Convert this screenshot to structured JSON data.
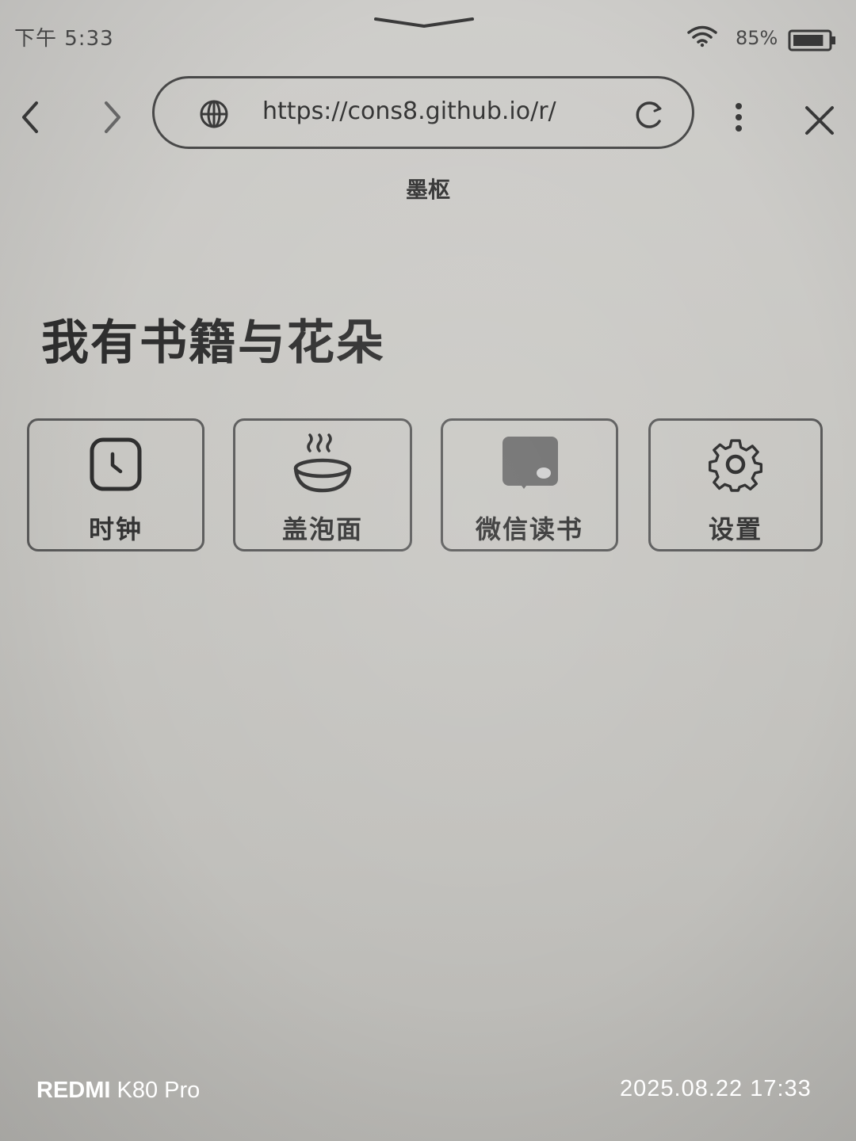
{
  "status_bar": {
    "time": "下午 5:33",
    "battery_percent": "85%",
    "battery_level": 0.85
  },
  "browser": {
    "url": "https://cons8.github.io/r/",
    "page_title": "墨枢"
  },
  "page": {
    "heading": "我有书籍与花朵",
    "apps": [
      {
        "label": "时钟",
        "icon": "clock-icon"
      },
      {
        "label": "盖泡面",
        "icon": "noodle-bowl-icon"
      },
      {
        "label": "微信读书",
        "icon": "wechat-read-icon"
      },
      {
        "label": "设置",
        "icon": "gear-icon"
      }
    ]
  },
  "camera_watermark": {
    "brand": "REDMI",
    "model": "K80 Pro",
    "timestamp": "2025.08.22 17:33"
  }
}
